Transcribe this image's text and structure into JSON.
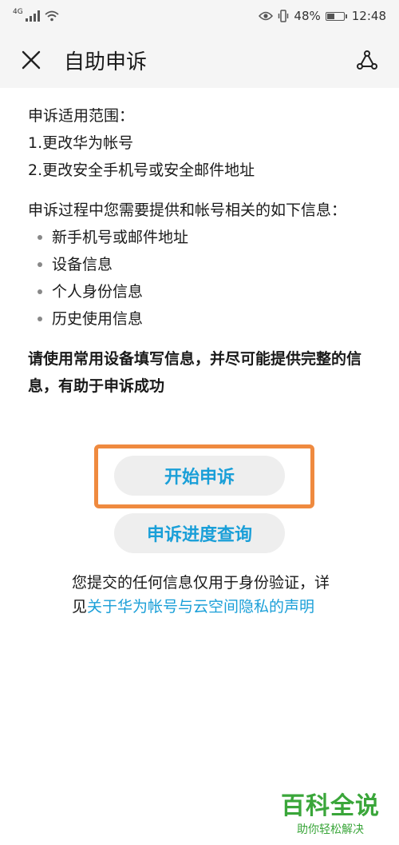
{
  "status_bar": {
    "signal_label": "4G",
    "battery_percent": "48%",
    "battery_level": 0.48,
    "time": "12:48",
    "icons": [
      "signal-icon",
      "wifi-icon",
      "eye-icon",
      "vibrate-icon",
      "battery-icon"
    ]
  },
  "app_bar": {
    "title": "自助申诉",
    "icons": [
      "close-icon",
      "share-icon"
    ]
  },
  "content": {
    "scope_title": "申诉适用范围：",
    "scope_items": [
      "1.更改华为帐号",
      "2.更改安全手机号或安全邮件地址"
    ],
    "info_intro": "申诉过程中您需要提供和帐号相关的如下信息：",
    "info_items": [
      "新手机号或邮件地址",
      "设备信息",
      "个人身份信息",
      "历史使用信息"
    ],
    "notice": "请使用常用设备填写信息，并尽可能提供完整的信息，有助于申诉成功"
  },
  "buttons": {
    "start": "开始申诉",
    "progress": "申诉进度查询"
  },
  "privacy": {
    "line1": "您提交的任何信息仅用于身份验证，详",
    "line2_prefix": "见",
    "link": "关于华为帐号与云空间隐私的声明"
  },
  "watermark": {
    "main": "百科全说",
    "sub": "助你轻松解决"
  },
  "colors": {
    "accent": "#1a9fd8",
    "highlight": "#ef8a3f",
    "watermark": "#3aa63a"
  }
}
